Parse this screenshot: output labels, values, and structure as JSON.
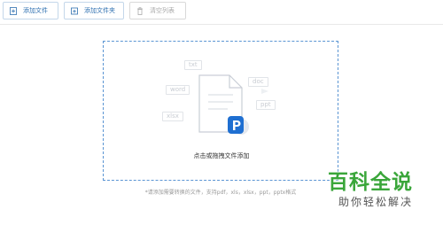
{
  "toolbar": {
    "add_file_label": "添加文件",
    "add_folder_label": "添加文件夹",
    "clear_list_label": "清空列表"
  },
  "dropzone": {
    "text": "点击或拖拽文件添加",
    "format_tags": {
      "txt": "txt",
      "word": "word",
      "doc": "doc",
      "ppt": "ppt",
      "xlsx": "xlsx"
    },
    "hint": "*请添加需要转换的文件，支持pdf，xls，xlsx，ppt，pptx格式"
  },
  "watermark": {
    "logo_text": "百科全说",
    "subtitle": "助你轻松解决"
  },
  "colors": {
    "accent": "#2d6fb0",
    "dashed_border": "#5b95d3",
    "watermark_green": "#3aa63a"
  }
}
